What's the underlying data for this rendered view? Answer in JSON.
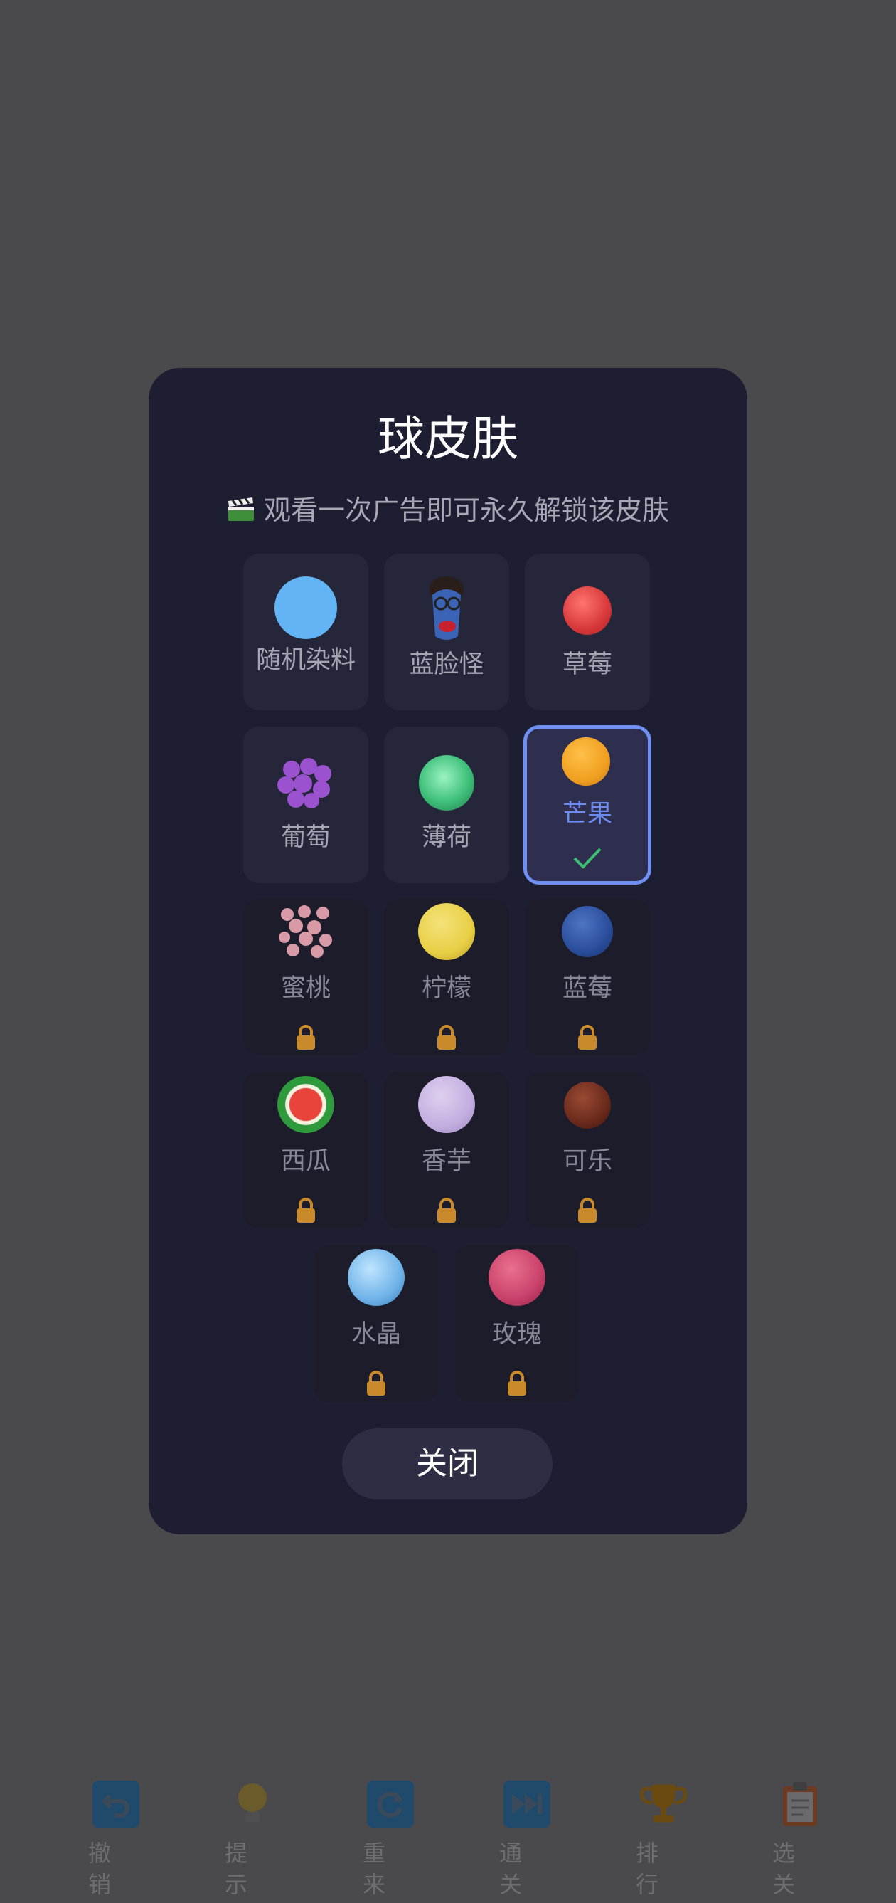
{
  "modal": {
    "title": "球皮肤",
    "subtitle": "观看一次广告即可永久解锁该皮肤",
    "close_label": "关闭"
  },
  "skins": [
    {
      "name": "随机染料",
      "state": "unlocked",
      "icon": "random-dye-ball-icon",
      "color": "#62b4f4"
    },
    {
      "name": "蓝脸怪",
      "state": "unlocked",
      "icon": "blue-face-monster-icon",
      "color": "#2f5aa8"
    },
    {
      "name": "草莓",
      "state": "unlocked",
      "icon": "strawberry-ball-icon",
      "color": "#e0433f"
    },
    {
      "name": "葡萄",
      "state": "unlocked",
      "icon": "grape-ball-icon",
      "color": "#9a52cf"
    },
    {
      "name": "薄荷",
      "state": "unlocked",
      "icon": "mint-ball-icon",
      "color": "#3fc07a"
    },
    {
      "name": "芒果",
      "state": "selected",
      "icon": "mango-ball-icon",
      "color": "#f0a020"
    },
    {
      "name": "蜜桃",
      "state": "locked",
      "icon": "peach-ball-icon",
      "color": "#d89aa6"
    },
    {
      "name": "柠檬",
      "state": "locked",
      "icon": "lemon-ball-icon",
      "color": "#e8cf45"
    },
    {
      "name": "蓝莓",
      "state": "locked",
      "icon": "blueberry-ball-icon",
      "color": "#2a4e9c"
    },
    {
      "name": "西瓜",
      "state": "locked",
      "icon": "watermelon-ball-icon",
      "color": "#2e9a3c"
    },
    {
      "name": "香芋",
      "state": "locked",
      "icon": "taro-ball-icon",
      "color": "#c3aee0"
    },
    {
      "name": "可乐",
      "state": "locked",
      "icon": "cola-ball-icon",
      "color": "#6a2a1c"
    },
    {
      "name": "水晶",
      "state": "locked",
      "icon": "crystal-ball-icon",
      "color": "#6fb3e8"
    },
    {
      "name": "玫瑰",
      "state": "locked",
      "icon": "rose-ball-icon",
      "color": "#c9416a"
    }
  ],
  "toolbar": [
    {
      "label": "撤销",
      "icon": "undo-icon",
      "color": "#1f4a6b"
    },
    {
      "label": "提示",
      "icon": "lightbulb-icon",
      "color": "#6b5a2a"
    },
    {
      "label": "重来",
      "icon": "restart-icon",
      "color": "#1f4a6b"
    },
    {
      "label": "通关",
      "icon": "skip-forward-icon",
      "color": "#1f4a6b"
    },
    {
      "label": "排行",
      "icon": "trophy-icon",
      "color": "#6b4a10"
    },
    {
      "label": "选关",
      "icon": "clipboard-icon",
      "color": "#6b3a20"
    }
  ],
  "colors": {
    "backdrop": "#4a4a4c",
    "modal_bg": "#1e1e33",
    "tile_bg": "#26263b",
    "accent": "#6f8ff2",
    "lock": "#c98a2c",
    "check": "#3fbf73"
  }
}
